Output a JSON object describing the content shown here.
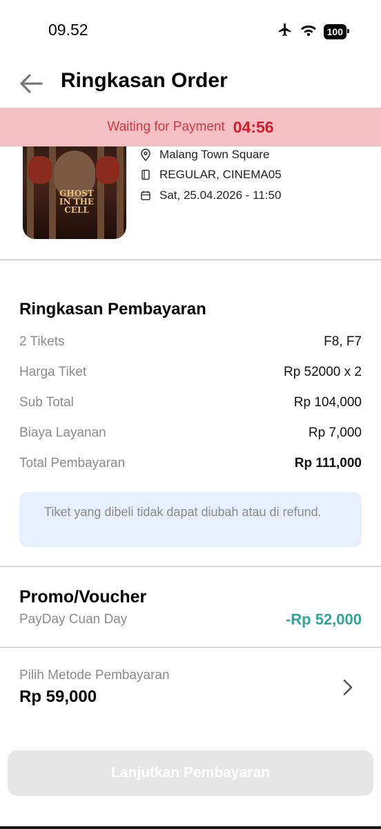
{
  "status_bar": {
    "time": "09.52",
    "battery": "100"
  },
  "header": {
    "title": "Ringkasan Order"
  },
  "payment_banner": {
    "text": "Waiting for Payment",
    "timer": "04:56"
  },
  "movie": {
    "poster_title": "GHOST IN THE CELL",
    "location": "Malang Town Square",
    "studio": "REGULAR, CINEMA05",
    "datetime": "Sat, 25.04.2026 - 11:50"
  },
  "summary": {
    "title": "Ringkasan Pembayaran",
    "rows": [
      {
        "label": "2 Tikets",
        "value": "F8, F7"
      },
      {
        "label": "Harga Tiket",
        "value": "Rp 52000 x 2"
      },
      {
        "label": "Sub Total",
        "value": "Rp 104,000"
      },
      {
        "label": "Biaya Layanan",
        "value": "Rp 7,000"
      },
      {
        "label": "Total Pembayaran",
        "value": "Rp 111,000"
      }
    ],
    "notice": "Tiket yang dibeli tidak dapat diubah atau di refund."
  },
  "promo": {
    "title": "Promo/Voucher",
    "name": "PayDay Cuan Day",
    "discount": "-Rp 52,000"
  },
  "payment_method": {
    "label": "Pilih Metode Pembayaran",
    "amount": "Rp 59,000"
  },
  "continue_button": {
    "label": "Lanjutkan Pembayaran"
  },
  "colors": {
    "banner_bg": "#f4bfc3",
    "banner_text": "#d21e2b",
    "discount": "#2ea69a",
    "notice_bg": "#e7effd",
    "button_disabled": "#e6e6e6"
  }
}
